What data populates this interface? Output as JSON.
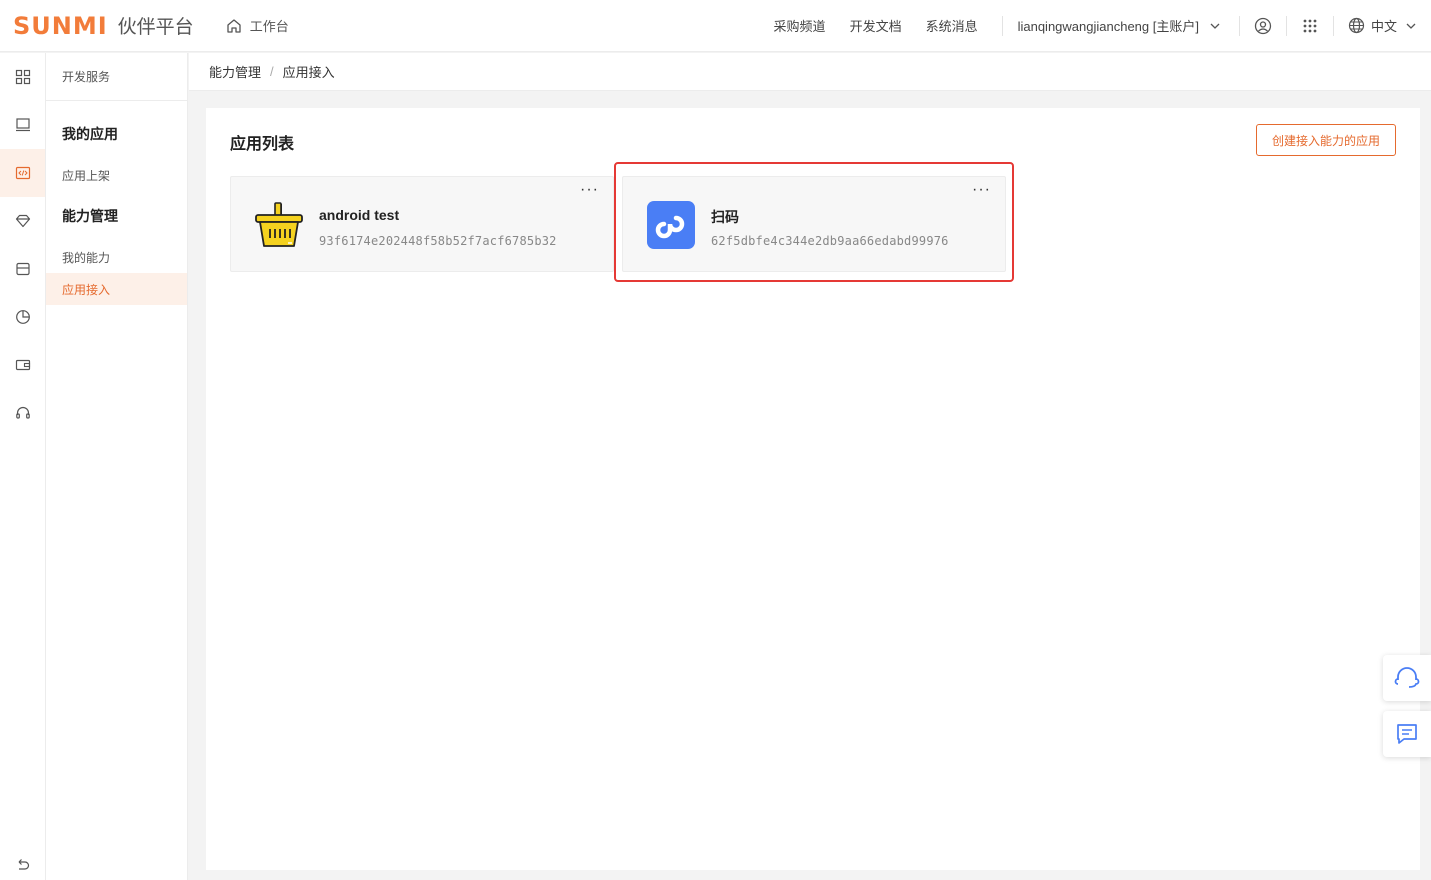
{
  "header": {
    "logo_mark": "SUNMI",
    "logo_text": "伙伴平台",
    "workbench_label": "工作台",
    "links": [
      "采购频道",
      "开发文档",
      "系统消息"
    ],
    "account_label": "lianqingwangjiancheng [主账户]",
    "language_label": "中文"
  },
  "sidebar": {
    "top_label": "开发服务",
    "groups": [
      {
        "title": "我的应用",
        "items": [
          "应用上架"
        ]
      },
      {
        "title": "能力管理",
        "items": [
          "我的能力",
          "应用接入"
        ]
      }
    ]
  },
  "breadcrumb": [
    "能力管理",
    "应用接入"
  ],
  "main": {
    "title": "应用列表",
    "create_button": "创建接入能力的应用",
    "apps": [
      {
        "name": "android test",
        "id": "93f6174e202448f58b52f7acf6785b32",
        "icon": "basket-icon"
      },
      {
        "name": "扫码",
        "id": "62f5dbfe4c344e2db9aa66edabd99976",
        "icon": "link-app-icon"
      }
    ],
    "more_label": "···"
  },
  "colors": {
    "accent": "#e56a2e",
    "highlight": "#e53935",
    "app_blue": "#4a7ef5",
    "basket_yellow": "#f5d21f"
  }
}
